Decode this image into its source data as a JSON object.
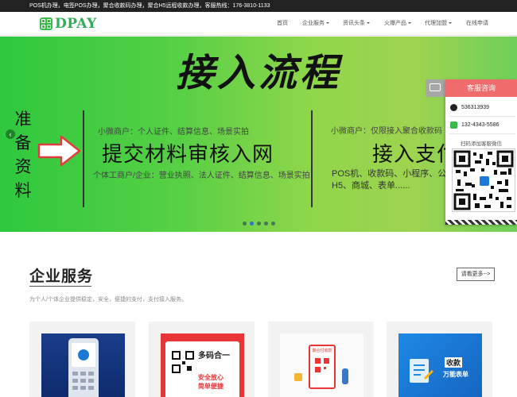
{
  "topbar": {
    "text": "POS机办理，电签POS办理，聚合收款码办理，聚合H5远程收款办理，客服热线：176-3810-1133"
  },
  "logo": {
    "text": "DPAY"
  },
  "nav": [
    {
      "label": "首页",
      "dropdown": false
    },
    {
      "label": "企业服务",
      "dropdown": true
    },
    {
      "label": "资讯头条",
      "dropdown": true
    },
    {
      "label": "火爆产品",
      "dropdown": true
    },
    {
      "label": "代理加盟",
      "dropdown": true
    },
    {
      "label": "在线申请",
      "dropdown": false
    }
  ],
  "banner": {
    "title": "接入流程",
    "prepare": [
      "准",
      "备",
      "资",
      "料"
    ],
    "middle": {
      "small_top": "小微商户：个人证件、结算信息、场景实拍",
      "big": "提交材料审核入网",
      "small_bottom": "个体工商户/企业：营业执照、法人证件、结算信息、场景实拍"
    },
    "right": {
      "small_top": "小微商户：仅限接入聚合收款码",
      "big": "接入支付",
      "desc_line1": "POS机、收款码、小程序、公",
      "desc_line2": "H5、商城、表单......"
    },
    "dots": 5,
    "active_dot": 1
  },
  "consult": {
    "header": "客服咨询",
    "qq": "536313939",
    "wechat": "132-4343-5586",
    "note": "扫码添加客服微信"
  },
  "section": {
    "title": "企业服务",
    "subtitle": "为个人/个体企业提供稳定，安全，便捷的支付，支付接入服务。",
    "more": "请看更多-->"
  },
  "cards": [
    {
      "img": "pos-terminal"
    },
    {
      "img": "qr-stand",
      "headline": "多码合一",
      "sub1": "安全放心",
      "sub2": "简单便捷"
    },
    {
      "img": "aggregate-payment",
      "label": "聚合付收款"
    },
    {
      "img": "receipt-form",
      "line1": "收款",
      "line2": "万能表单"
    }
  ],
  "colors": {
    "accent_green": "#2fae56",
    "consult_red": "#f06b6b",
    "topbar": "#222222"
  }
}
